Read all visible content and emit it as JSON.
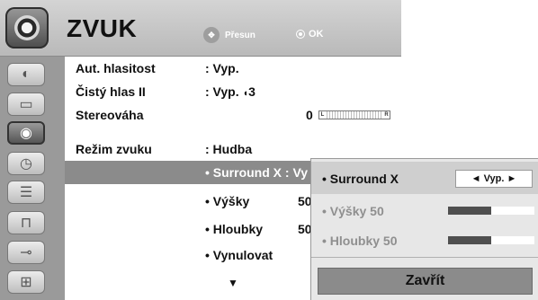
{
  "header": {
    "title": "ZVUK",
    "move_hint": "Přesun",
    "ok_hint": "OK"
  },
  "sidebar": {
    "items": [
      {
        "icon": "satellite-icon",
        "glyph": "◐"
      },
      {
        "icon": "monitor-icon",
        "glyph": "▭"
      },
      {
        "icon": "speaker-icon",
        "glyph": "◉",
        "active": true
      },
      {
        "icon": "clock-icon",
        "glyph": "◷"
      },
      {
        "icon": "options-icon",
        "glyph": "☰"
      },
      {
        "icon": "lock-icon",
        "glyph": "🔒"
      },
      {
        "icon": "input-plug-icon",
        "glyph": "⊸"
      },
      {
        "icon": "usb-icon",
        "glyph": "⊞"
      }
    ]
  },
  "menu": {
    "auto_volume": {
      "label": "Aut. hlasitost",
      "value": ": Vyp."
    },
    "clear_voice": {
      "label": "Čistý hlas II",
      "value": ": Vyp. ",
      "level": "3"
    },
    "balance": {
      "label": "Stereováha",
      "value": "0",
      "left_mark": "L",
      "right_mark": "R"
    },
    "sound_mode": {
      "label": "Režim zvuku",
      "value": ": Hudba"
    },
    "surround": {
      "value": "• Surround X : Vy"
    },
    "treble": {
      "value": "• Výšky",
      "num": "50"
    },
    "bass": {
      "value": "• Hloubky",
      "num": "50"
    },
    "reset": {
      "value": "• Vynulovat"
    },
    "more_arrow": "▼"
  },
  "popup": {
    "surround": {
      "label": "• Surround X",
      "value": "◄ Vyp. ►"
    },
    "treble": {
      "label": "• Výšky 50",
      "level": 0.5
    },
    "bass": {
      "label": "• Hloubky 50",
      "level": 0.5
    },
    "close_label": "Zavřít"
  }
}
